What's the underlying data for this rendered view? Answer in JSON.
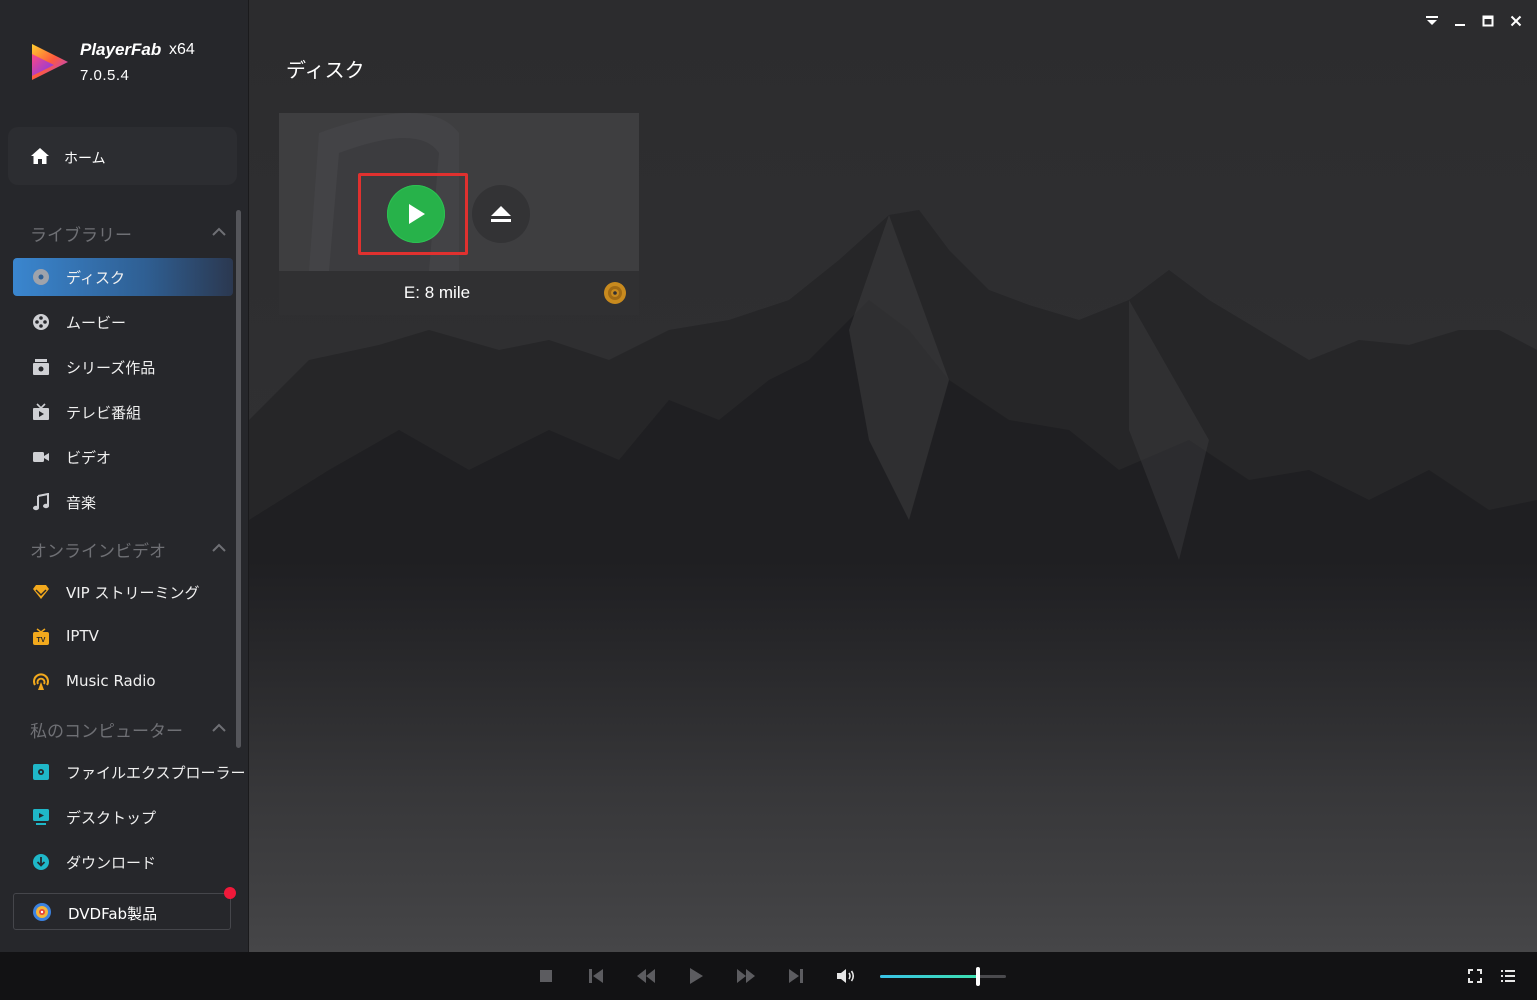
{
  "app": {
    "name": "PlayerFab",
    "arch": "x64",
    "version": "7.0.5.4"
  },
  "sidebar": {
    "home_label": "ホーム",
    "sections": {
      "library": "ライブラリー",
      "online": "オンラインビデオ",
      "computer": "私のコンピューター"
    },
    "library_items": [
      {
        "label": "ディスク",
        "icon": "disc-icon",
        "active": true
      },
      {
        "label": "ムービー",
        "icon": "film-reel-icon"
      },
      {
        "label": "シリーズ作品",
        "icon": "series-icon"
      },
      {
        "label": "テレビ番組",
        "icon": "tv-icon"
      },
      {
        "label": "ビデオ",
        "icon": "video-camera-icon"
      },
      {
        "label": "音楽",
        "icon": "music-note-icon"
      }
    ],
    "online_items": [
      {
        "label": "VIP ストリーミング",
        "icon": "vip-diamond-icon"
      },
      {
        "label": "IPTV",
        "icon": "iptv-icon"
      },
      {
        "label": "Music Radio",
        "icon": "radio-icon"
      }
    ],
    "computer_items": [
      {
        "label": "ファイルエクスプローラー",
        "icon": "file-explorer-icon"
      },
      {
        "label": "デスクトップ",
        "icon": "desktop-icon"
      },
      {
        "label": "ダウンロード",
        "icon": "download-icon"
      }
    ],
    "dvdfab_label": "DVDFab製品"
  },
  "main": {
    "title": "ディスク",
    "disc": {
      "label": "E: 8 mile"
    }
  },
  "player": {
    "volume_level": 0.78
  },
  "colors": {
    "accent": "#3a86cf",
    "play_green": "#27b24a",
    "highlight_red": "#e0312f",
    "disc_gold": "#c88a1e"
  }
}
